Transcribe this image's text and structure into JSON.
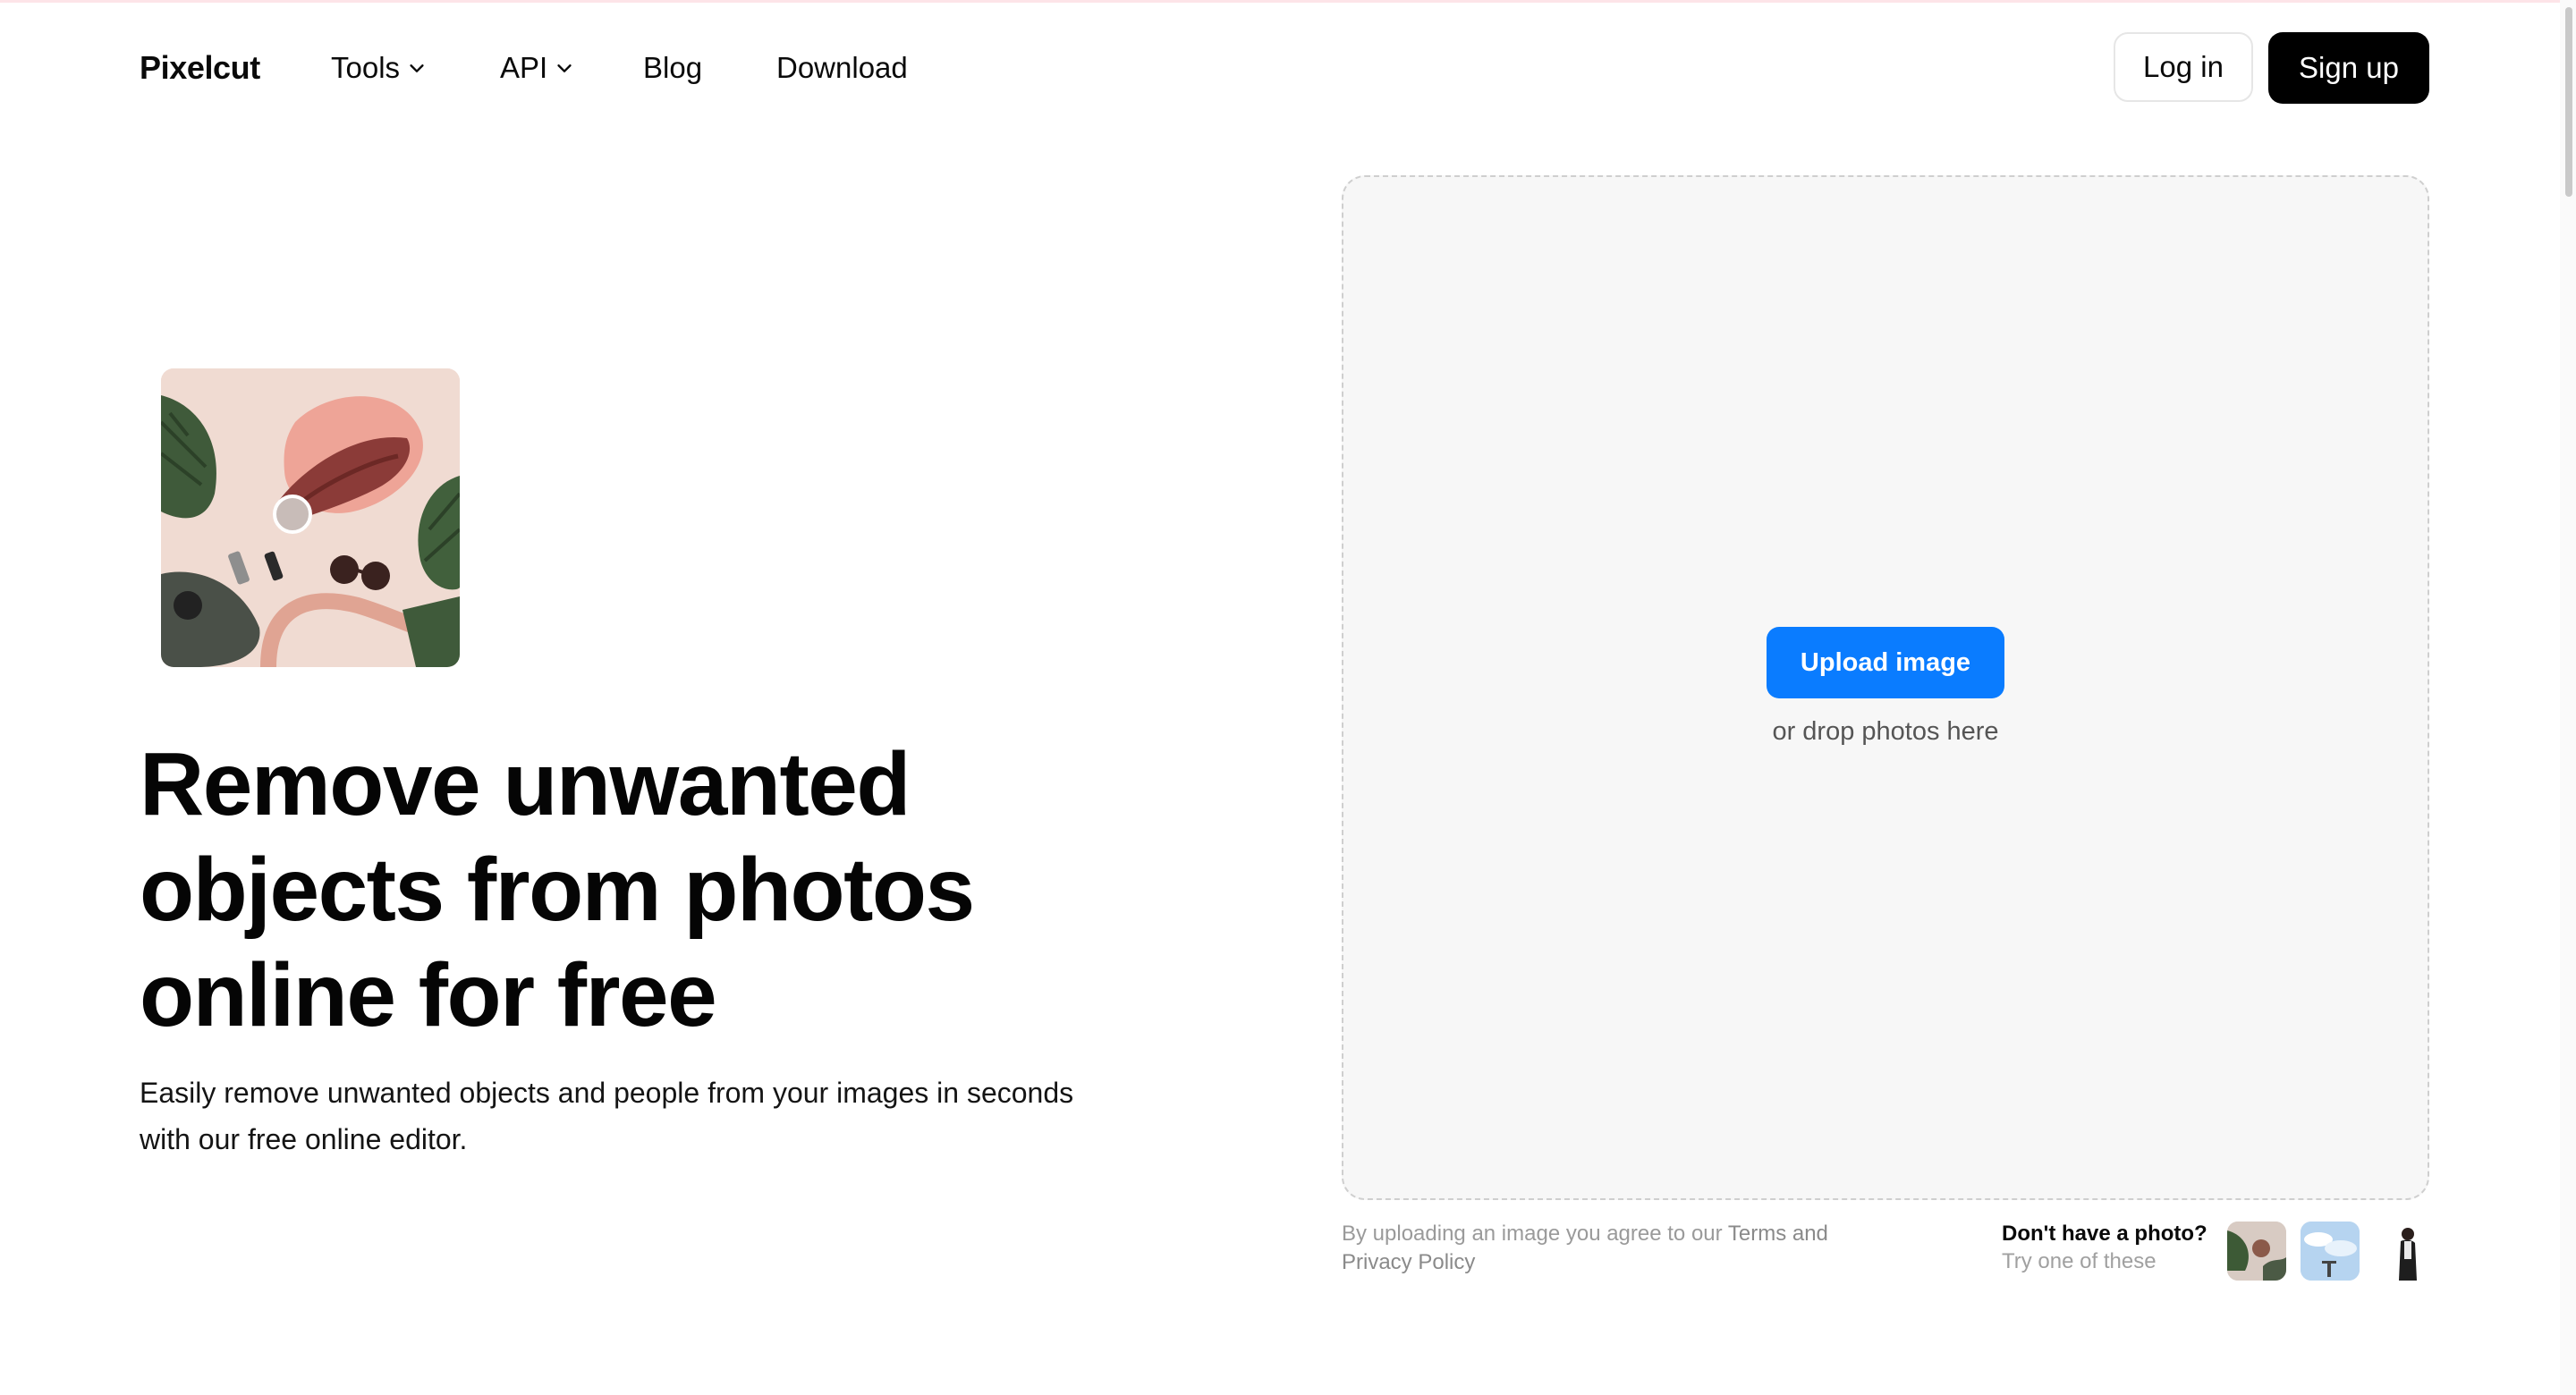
{
  "nav": {
    "logo": "Pixelcut",
    "items": [
      {
        "label": "Tools"
      },
      {
        "label": "API"
      },
      {
        "label": "Blog"
      },
      {
        "label": "Download"
      }
    ],
    "login_label": "Log in",
    "signup_label": "Sign up"
  },
  "hero": {
    "title": "Remove unwanted objects from photos online for free",
    "subtitle": "Easily remove unwanted objects and people from your images in seconds with our free online editor."
  },
  "upload": {
    "button_label": "Upload image",
    "hint": "or drop photos here",
    "legal_prefix": "By uploading an image you agree to our ",
    "legal_links": "Terms and Privacy Policy"
  },
  "samples": {
    "question": "Don't have a photo?",
    "prompt": "Try one of these"
  },
  "colors": {
    "accent": "#0a7cff",
    "signup_bg": "#000000",
    "dropzone_bg": "#f7f7f7"
  }
}
